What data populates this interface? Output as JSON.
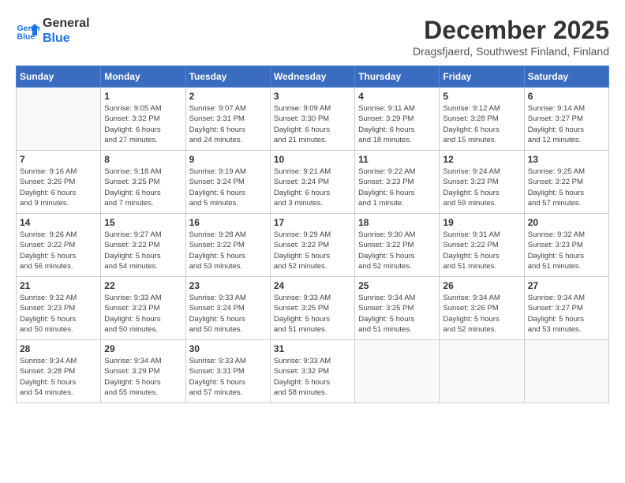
{
  "header": {
    "logo_line1": "General",
    "logo_line2": "Blue",
    "month_year": "December 2025",
    "location": "Dragsfjaerd, Southwest Finland, Finland"
  },
  "weekdays": [
    "Sunday",
    "Monday",
    "Tuesday",
    "Wednesday",
    "Thursday",
    "Friday",
    "Saturday"
  ],
  "weeks": [
    [
      {
        "day": "",
        "info": ""
      },
      {
        "day": "1",
        "info": "Sunrise: 9:05 AM\nSunset: 3:32 PM\nDaylight: 6 hours\nand 27 minutes."
      },
      {
        "day": "2",
        "info": "Sunrise: 9:07 AM\nSunset: 3:31 PM\nDaylight: 6 hours\nand 24 minutes."
      },
      {
        "day": "3",
        "info": "Sunrise: 9:09 AM\nSunset: 3:30 PM\nDaylight: 6 hours\nand 21 minutes."
      },
      {
        "day": "4",
        "info": "Sunrise: 9:11 AM\nSunset: 3:29 PM\nDaylight: 6 hours\nand 18 minutes."
      },
      {
        "day": "5",
        "info": "Sunrise: 9:12 AM\nSunset: 3:28 PM\nDaylight: 6 hours\nand 15 minutes."
      },
      {
        "day": "6",
        "info": "Sunrise: 9:14 AM\nSunset: 3:27 PM\nDaylight: 6 hours\nand 12 minutes."
      }
    ],
    [
      {
        "day": "7",
        "info": "Sunrise: 9:16 AM\nSunset: 3:26 PM\nDaylight: 6 hours\nand 9 minutes."
      },
      {
        "day": "8",
        "info": "Sunrise: 9:18 AM\nSunset: 3:25 PM\nDaylight: 6 hours\nand 7 minutes."
      },
      {
        "day": "9",
        "info": "Sunrise: 9:19 AM\nSunset: 3:24 PM\nDaylight: 6 hours\nand 5 minutes."
      },
      {
        "day": "10",
        "info": "Sunrise: 9:21 AM\nSunset: 3:24 PM\nDaylight: 6 hours\nand 3 minutes."
      },
      {
        "day": "11",
        "info": "Sunrise: 9:22 AM\nSunset: 3:23 PM\nDaylight: 6 hours\nand 1 minute."
      },
      {
        "day": "12",
        "info": "Sunrise: 9:24 AM\nSunset: 3:23 PM\nDaylight: 5 hours\nand 59 minutes."
      },
      {
        "day": "13",
        "info": "Sunrise: 9:25 AM\nSunset: 3:22 PM\nDaylight: 5 hours\nand 57 minutes."
      }
    ],
    [
      {
        "day": "14",
        "info": "Sunrise: 9:26 AM\nSunset: 3:22 PM\nDaylight: 5 hours\nand 56 minutes."
      },
      {
        "day": "15",
        "info": "Sunrise: 9:27 AM\nSunset: 3:22 PM\nDaylight: 5 hours\nand 54 minutes."
      },
      {
        "day": "16",
        "info": "Sunrise: 9:28 AM\nSunset: 3:22 PM\nDaylight: 5 hours\nand 53 minutes."
      },
      {
        "day": "17",
        "info": "Sunrise: 9:29 AM\nSunset: 3:22 PM\nDaylight: 5 hours\nand 52 minutes."
      },
      {
        "day": "18",
        "info": "Sunrise: 9:30 AM\nSunset: 3:22 PM\nDaylight: 5 hours\nand 52 minutes."
      },
      {
        "day": "19",
        "info": "Sunrise: 9:31 AM\nSunset: 3:22 PM\nDaylight: 5 hours\nand 51 minutes."
      },
      {
        "day": "20",
        "info": "Sunrise: 9:32 AM\nSunset: 3:23 PM\nDaylight: 5 hours\nand 51 minutes."
      }
    ],
    [
      {
        "day": "21",
        "info": "Sunrise: 9:32 AM\nSunset: 3:23 PM\nDaylight: 5 hours\nand 50 minutes."
      },
      {
        "day": "22",
        "info": "Sunrise: 9:33 AM\nSunset: 3:23 PM\nDaylight: 5 hours\nand 50 minutes."
      },
      {
        "day": "23",
        "info": "Sunrise: 9:33 AM\nSunset: 3:24 PM\nDaylight: 5 hours\nand 50 minutes."
      },
      {
        "day": "24",
        "info": "Sunrise: 9:33 AM\nSunset: 3:25 PM\nDaylight: 5 hours\nand 51 minutes."
      },
      {
        "day": "25",
        "info": "Sunrise: 9:34 AM\nSunset: 3:25 PM\nDaylight: 5 hours\nand 51 minutes."
      },
      {
        "day": "26",
        "info": "Sunrise: 9:34 AM\nSunset: 3:26 PM\nDaylight: 5 hours\nand 52 minutes."
      },
      {
        "day": "27",
        "info": "Sunrise: 9:34 AM\nSunset: 3:27 PM\nDaylight: 5 hours\nand 53 minutes."
      }
    ],
    [
      {
        "day": "28",
        "info": "Sunrise: 9:34 AM\nSunset: 3:28 PM\nDaylight: 5 hours\nand 54 minutes."
      },
      {
        "day": "29",
        "info": "Sunrise: 9:34 AM\nSunset: 3:29 PM\nDaylight: 5 hours\nand 55 minutes."
      },
      {
        "day": "30",
        "info": "Sunrise: 9:33 AM\nSunset: 3:31 PM\nDaylight: 5 hours\nand 57 minutes."
      },
      {
        "day": "31",
        "info": "Sunrise: 9:33 AM\nSunset: 3:32 PM\nDaylight: 5 hours\nand 58 minutes."
      },
      {
        "day": "",
        "info": ""
      },
      {
        "day": "",
        "info": ""
      },
      {
        "day": "",
        "info": ""
      }
    ]
  ]
}
